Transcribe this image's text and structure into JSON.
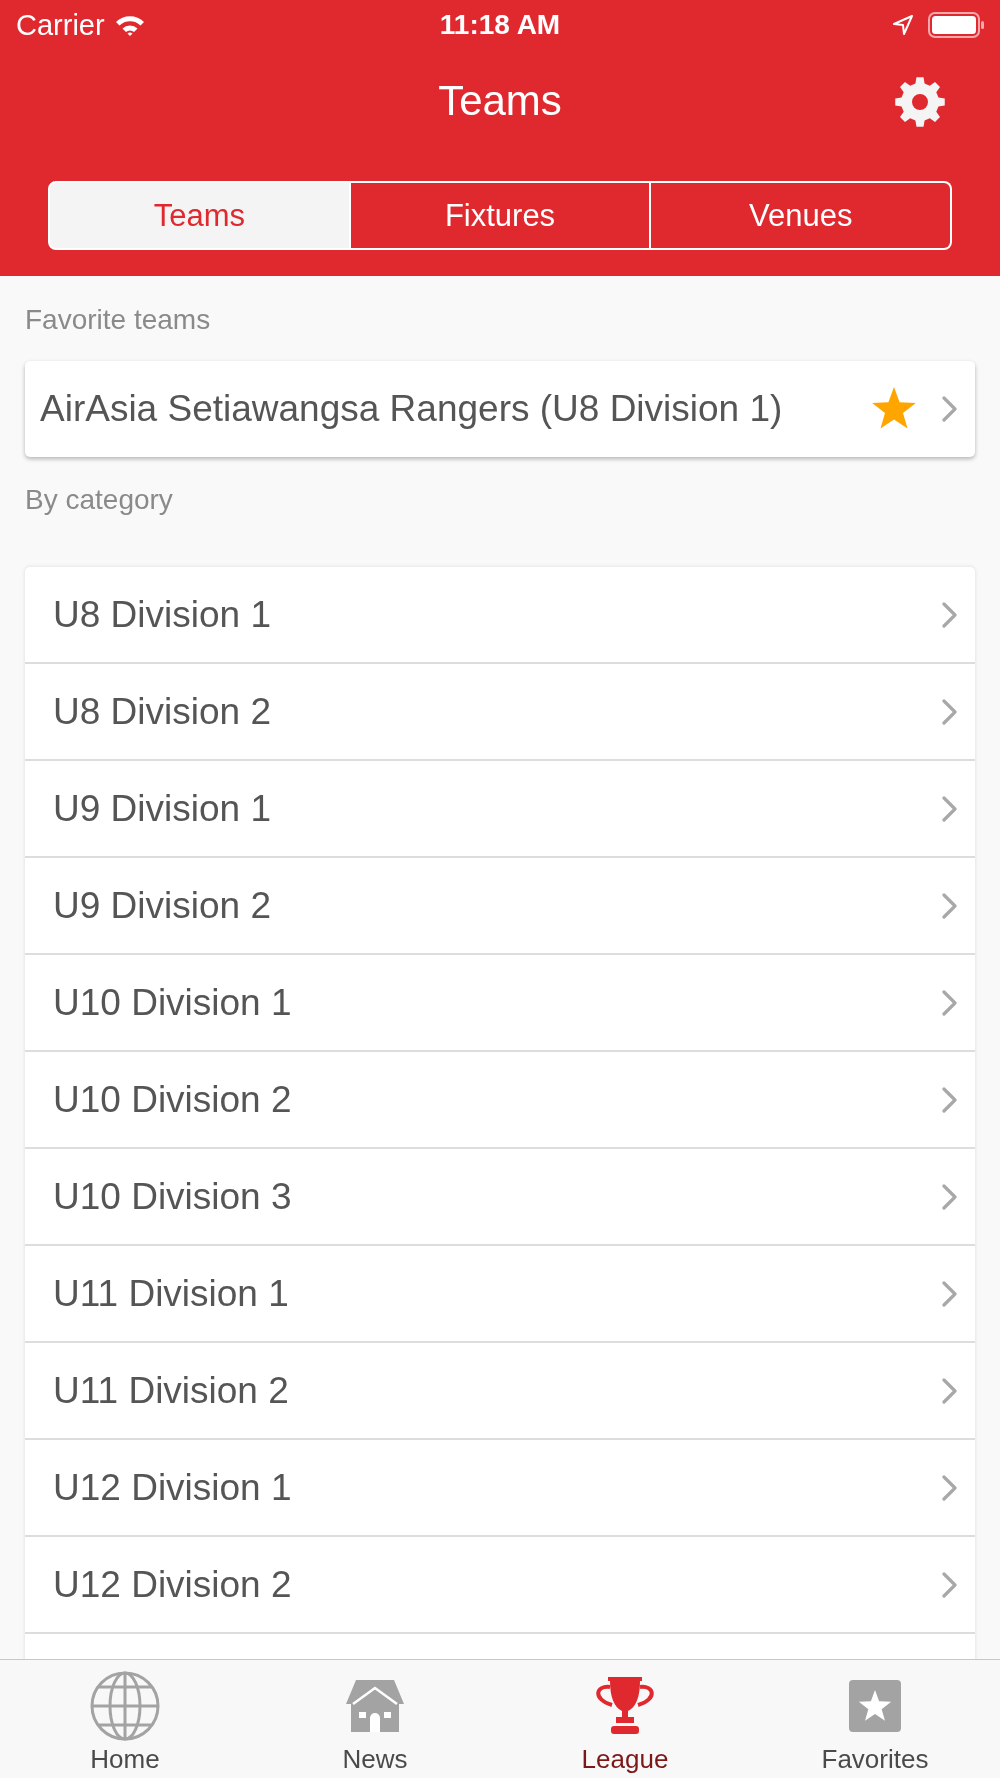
{
  "status_bar": {
    "carrier": "Carrier",
    "time": "11:18 AM"
  },
  "header": {
    "title": "Teams"
  },
  "segments": [
    {
      "label": "Teams",
      "selected": true
    },
    {
      "label": "Fixtures",
      "selected": false
    },
    {
      "label": "Venues",
      "selected": false
    }
  ],
  "favorites": {
    "heading": "Favorite teams",
    "items": [
      {
        "name": "AirAsia Setiawangsa Rangers (U8 Division 1)",
        "starred": true
      }
    ]
  },
  "categories": {
    "heading": "By category",
    "items": [
      "U8 Division 1",
      "U8 Division 2",
      "U9 Division 1",
      "U9 Division 2",
      "U10 Division 1",
      "U10 Division 2",
      "U10 Division 3",
      "U11 Division 1",
      "U11 Division 2",
      "U12 Division 1",
      "U12 Division 2"
    ]
  },
  "tab_bar": [
    {
      "label": "Home",
      "kind": "globe",
      "selected": false
    },
    {
      "label": "News",
      "kind": "house",
      "selected": false
    },
    {
      "label": "League",
      "kind": "trophy",
      "selected": true
    },
    {
      "label": "Favorites",
      "kind": "star",
      "selected": false
    }
  ]
}
